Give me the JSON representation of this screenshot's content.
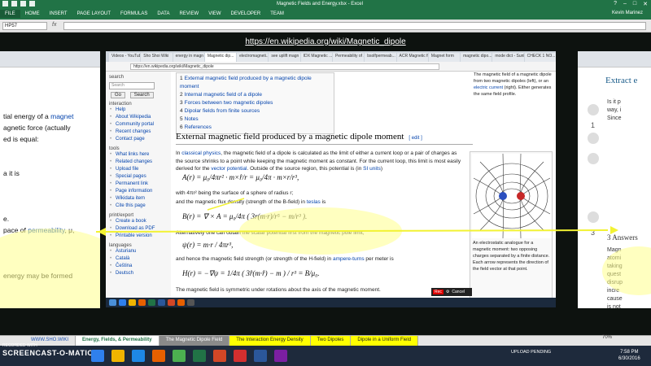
{
  "excel": {
    "title": "Magnetic Fields and Energy.xlsx - Excel",
    "ribbon_tabs": [
      "FILE",
      "HOME",
      "INSERT",
      "PAGE LAYOUT",
      "FORMULAS",
      "DATA",
      "REVIEW",
      "VIEW",
      "DEVELOPER",
      "TEAM"
    ],
    "user": "Kevin Marinez",
    "namebox": "HP57",
    "fx": "fx"
  },
  "banner_url": "https://en.wikipedia.org/wiki/Magnetic_dipole",
  "left_window": {
    "lines": [
      {
        "pre": "tial energy of a ",
        "link": "magnet",
        "post": ""
      },
      {
        "pre": "agnetic force (actually",
        "link": "",
        "post": ""
      },
      {
        "pre": "ed is equal:",
        "link": "",
        "post": ""
      },
      {
        "pre": "",
        "link": "",
        "post": ""
      },
      {
        "pre": "",
        "link": "",
        "post": ""
      },
      {
        "pre": "a it is",
        "link": "",
        "post": ""
      },
      {
        "pre": "",
        "link": "",
        "post": ""
      },
      {
        "pre": "",
        "link": "",
        "post": ""
      },
      {
        "pre": "",
        "link": "",
        "post": ""
      },
      {
        "pre": "e.",
        "link": "",
        "post": ""
      },
      {
        "pre": "pace of ",
        "link": "permeability",
        "post": ", μ,"
      },
      {
        "pre": "",
        "link": "",
        "post": ""
      },
      {
        "pre": "",
        "link": "",
        "post": ""
      },
      {
        "pre": "",
        "link": "",
        "post": ""
      },
      {
        "pre": "energy may be formed",
        "link": "",
        "post": ""
      }
    ]
  },
  "right_window": {
    "header": "Extract e",
    "snippet": [
      "Is it p",
      "way, i",
      "Since"
    ],
    "votes": [
      "1",
      "3"
    ],
    "answers_label": "3 Answers",
    "answer_snip": [
      "Magn",
      "atomi",
      "taking",
      "quest",
      "disrup",
      "incre",
      "cause",
      "is not"
    ]
  },
  "browser": {
    "tabs": [
      "Videos - YouTube",
      "Sho Shoi Wiki",
      "energy in magn",
      "Magnetic dip...",
      "electromagneti...",
      "see uplift magn",
      "IDX Magnetic ...",
      "Permeability of ...",
      "bsolfpermeab...",
      "ACR Magnetic fie...",
      "Magnet form",
      "magnetic dipo...",
      "mode dict - Sunli...",
      "CHECK 1 NO..."
    ],
    "address": "https://en.wikipedia.org/wiki/Magnetic_dipole"
  },
  "sidebar": {
    "search_label": "search",
    "search_placeholder": "Search",
    "go": "Go",
    "search_btn": "Search",
    "interaction_label": "interaction",
    "interaction": [
      "Help",
      "About Wikipedia",
      "Community portal",
      "Recent changes",
      "Contact page"
    ],
    "tools_label": "tools",
    "tools": [
      "What links here",
      "Related changes",
      "Upload file",
      "Special pages",
      "Permanent link",
      "Page information",
      "Wikidata item",
      "Cite this page"
    ],
    "export_label": "print/export",
    "export": [
      "Create a book",
      "Download as PDF",
      "Printable version"
    ],
    "languages_label": "languages",
    "languages": [
      "Asturianu",
      "Català",
      "Čeština",
      "Deutsch"
    ]
  },
  "article": {
    "toc": [
      {
        "num": "1",
        "text": "External magnetic field produced by a magnetic dipole moment"
      },
      {
        "num": "2",
        "text": "Internal magnetic field of a dipole"
      },
      {
        "num": "3",
        "text": "Forces between two magnetic dipoles"
      },
      {
        "num": "4",
        "text": "Dipolar fields from finite sources"
      },
      {
        "num": "5",
        "text": "Notes"
      },
      {
        "num": "6",
        "text": "References"
      }
    ],
    "top_caption_pre": "The magnetic field of a magnetic dipole from two magnetic dipoles (left), or an ",
    "top_caption_link": "electric current",
    "top_caption_post": " (right). Either generates the same field profile.",
    "section_title": "External magnetic field produced by a magnetic dipole moment",
    "edit": "[ edit ]",
    "p1_pre": "In ",
    "p1_link1": "classical physics",
    "p1_mid": ", the magnetic field of a dipole is calculated as the limit of either a current loop or a pair of charges as the source shrinks to a point while keeping the magnetic moment as constant. For the current loop, this limit is most easily derived for the ",
    "p1_link2": "vector potential",
    "p1_mid2": ". Outside of the source region, this potential is (in ",
    "p1_link3": "SI units",
    "p1_post": ")",
    "eq1": "A(r) = μ₀/4πr² · m×r̂/r = μ₀/4π · m×r/r³,",
    "p2": "with 4πr² being the surface of a sphere of radius r;",
    "p3_pre": "and the magnetic flux density (strength of the B-field) in ",
    "p3_link": "teslas",
    "p3_post": " is",
    "eq2": "B(r) = ∇ × A = μ₀/4π ( 3r(m·r)/r⁵ − m/r³ ).",
    "p4": "Alternatively one can obtain the scalar potential first from the magnetic pole limit,",
    "eq3": "ψ(r) = m·r / 4πr³,",
    "p5_pre": "and hence the magnetic field strength (or strength of the H-field) in ",
    "p5_link": "ampere-turns",
    "p5_post": " per meter is",
    "eq4": "H(r) = −∇ψ = 1/4π ( 3r̂(m·r̂) − m ) / r³ = B/μ₀.",
    "p6": "The magnetic field is symmetric under rotations about the axis of the magnetic moment.",
    "figure_caption": "An electrostatic analogue for a magnetic moment: two opposing charges separated by a finite distance. Each arrow represents the direction of the field vector at that point."
  },
  "recorder": {
    "rec": "Rec",
    "cancel": "Cancel"
  },
  "sheet_tabs": [
    {
      "label": "WWW.SHO.WIKI",
      "style": "plain"
    },
    {
      "label": "Energy, Fields, & Permeability",
      "style": "active"
    },
    {
      "label": "The Magnetic Dipole Field",
      "style": "gray"
    },
    {
      "label": "The Interaction Energy Density",
      "style": "yellow"
    },
    {
      "label": "Two Dipoles",
      "style": "yellow"
    },
    {
      "label": "Dipole in a Uniform Field",
      "style": "yellow"
    }
  ],
  "taskbar": {
    "recorded_with": "RECORDED WITH",
    "logo": "SCREENCAST-O-MATIC",
    "upload": "UPLOAD PENDING",
    "time": "7:58 PM",
    "date": "6/30/2016",
    "zoom": "70%"
  },
  "colors": {
    "excel_green": "#217346",
    "highlight_yellow": "#ffff00",
    "link_blue": "#0645ad"
  }
}
